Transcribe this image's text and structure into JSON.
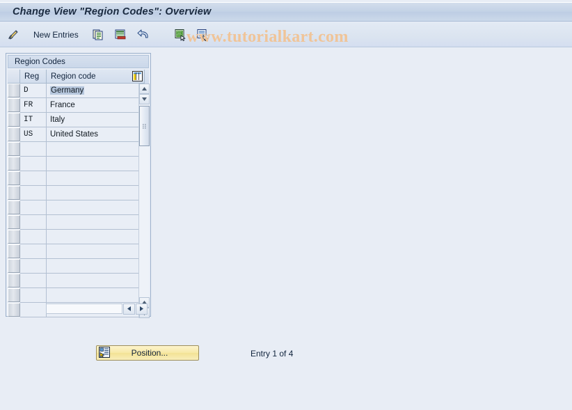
{
  "window": {
    "title": "Change View \"Region Codes\": Overview"
  },
  "watermark": {
    "text": "www.tutorialkart.com",
    "color": "#f0c498"
  },
  "toolbar": {
    "items": [
      {
        "icon": "pencil-edit-icon",
        "label": ""
      },
      {
        "icon": "",
        "label": "New Entries"
      },
      {
        "icon": "copy-icon",
        "label": ""
      },
      {
        "icon": "delete-row-icon",
        "label": ""
      },
      {
        "icon": "undo-icon",
        "label": ""
      },
      {
        "icon": "select-all-icon",
        "label": ""
      },
      {
        "icon": "deselect-all-icon",
        "label": ""
      }
    ],
    "new_entries_label": "New Entries"
  },
  "panel": {
    "title": "Region Codes"
  },
  "table": {
    "columns": [
      {
        "key": "reg",
        "label": "Reg"
      },
      {
        "key": "code",
        "label": "Region code"
      }
    ],
    "settings_icon": "table-settings-icon",
    "rows": [
      {
        "reg": "D",
        "code": "Germany",
        "selected": true
      },
      {
        "reg": "FR",
        "code": "France",
        "selected": false
      },
      {
        "reg": "IT",
        "code": "Italy",
        "selected": false
      },
      {
        "reg": "US",
        "code": "United States",
        "selected": false
      }
    ],
    "empty_row_count": 12
  },
  "footer": {
    "position_button_label": "Position...",
    "position_button_icon": "position-icon",
    "entry_status": "Entry 1 of 4"
  },
  "colors": {
    "background": "#e8edf5",
    "title_bar": "#c3d2e6",
    "accent_yellow": "#f3e295",
    "selection": "#b6c7dd"
  }
}
